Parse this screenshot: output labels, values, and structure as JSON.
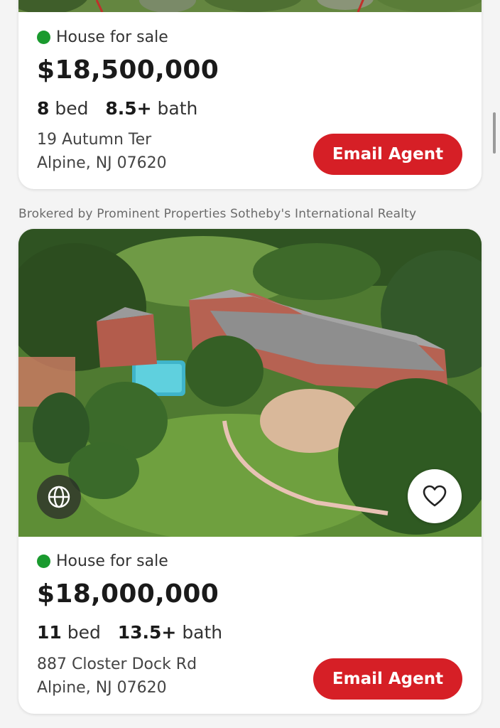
{
  "colors": {
    "status_green": "#1a9a2e",
    "button_red": "#d61f26"
  },
  "listings": [
    {
      "status": "House for sale",
      "price": "$18,500,000",
      "beds": "8",
      "beds_label": "bed",
      "baths": "8.5+",
      "baths_label": "bath",
      "address_line1": "19 Autumn Ter",
      "address_line2": "Alpine, NJ 07620",
      "email_button": "Email Agent"
    },
    {
      "broker": "Brokered by Prominent Properties Sotheby's International Realty",
      "status": "House for sale",
      "price": "$18,000,000",
      "beds": "11",
      "beds_label": "bed",
      "baths": "13.5+",
      "baths_label": "bath",
      "address_line1": "887 Closter Dock Rd",
      "address_line2": "Alpine, NJ 07620",
      "email_button": "Email Agent",
      "globe_icon": "globe-icon",
      "favorite_icon": "heart-icon"
    }
  ]
}
